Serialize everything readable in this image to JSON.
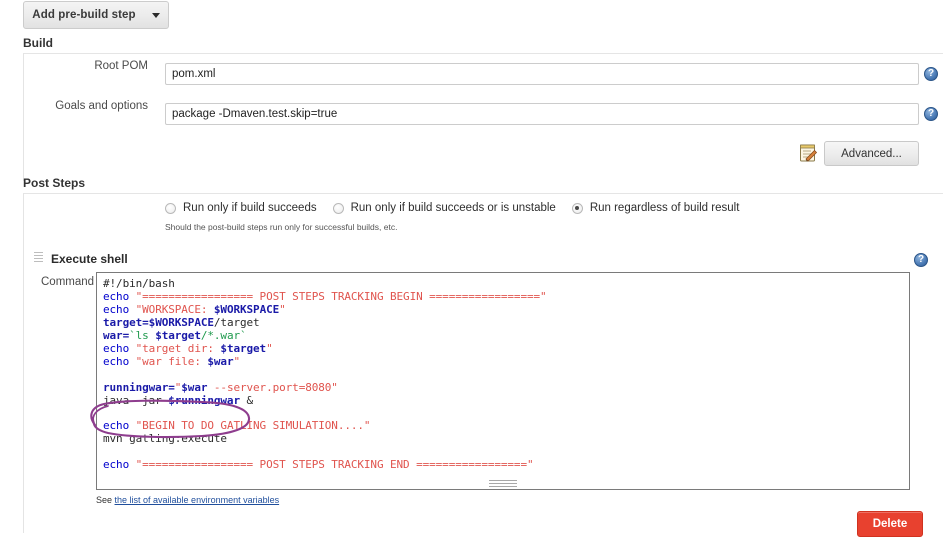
{
  "toolbar": {
    "add_prebuild_step_label": "Add pre-build step"
  },
  "build_section": {
    "heading": "Build",
    "rows": [
      {
        "label": "Root POM",
        "value": "pom.xml",
        "placeholder": ""
      },
      {
        "label": "Goals and options",
        "value": "package -Dmaven.test.skip=true",
        "placeholder": ""
      }
    ],
    "advanced_button_label": "Advanced..."
  },
  "post_steps_section": {
    "heading": "Post Steps",
    "radio_options": [
      {
        "label": "Run only if build succeeds",
        "checked": false
      },
      {
        "label": "Run only if build succeeds or is unstable",
        "checked": false
      },
      {
        "label": "Run regardless of build result",
        "checked": true
      }
    ],
    "hint": "Should the post-build steps run only for successful builds, etc."
  },
  "execute_shell": {
    "title": "Execute shell",
    "command_label": "Command",
    "script": "#!/bin/bash\necho \"================= POST STEPS TRACKING BEGIN =================\"\necho \"WORKSPACE: $WORKSPACE\"\ntarget=$WORKSPACE/target\nwar=`ls $target/*.war`\necho \"target dir: $target\"\necho \"war file: $war\"\n\nrunningwar=\"$war --server.port=8080\"\njava -jar $runningwar &\n\necho \"BEGIN TO DO GATLING SIMULATION....\"\nmvn gatling:execute\n\necho \"================= POST STEPS TRACKING END =================\"",
    "script_lines": [
      {
        "tokens": [
          {
            "t": "#!/bin/bash",
            "c": "c"
          }
        ]
      },
      {
        "tokens": [
          {
            "t": "echo",
            "c": "k"
          },
          {
            "t": " ",
            "c": "p"
          },
          {
            "t": "\"================= POST STEPS TRACKING BEGIN =================\"",
            "c": "s"
          }
        ]
      },
      {
        "tokens": [
          {
            "t": "echo",
            "c": "k"
          },
          {
            "t": " ",
            "c": "p"
          },
          {
            "t": "\"WORKSPACE: ",
            "c": "s"
          },
          {
            "t": "$WORKSPACE",
            "c": "v"
          },
          {
            "t": "\"",
            "c": "s"
          }
        ]
      },
      {
        "tokens": [
          {
            "t": "target=",
            "c": "v"
          },
          {
            "t": "$WORKSPACE",
            "c": "v"
          },
          {
            "t": "/target",
            "c": "p"
          }
        ]
      },
      {
        "tokens": [
          {
            "t": "war=",
            "c": "v"
          },
          {
            "t": "`ls ",
            "c": "g"
          },
          {
            "t": "$target",
            "c": "v"
          },
          {
            "t": "/*.war`",
            "c": "g"
          }
        ]
      },
      {
        "tokens": [
          {
            "t": "echo",
            "c": "k"
          },
          {
            "t": " ",
            "c": "p"
          },
          {
            "t": "\"target dir: ",
            "c": "s"
          },
          {
            "t": "$target",
            "c": "v"
          },
          {
            "t": "\"",
            "c": "s"
          }
        ]
      },
      {
        "tokens": [
          {
            "t": "echo",
            "c": "k"
          },
          {
            "t": " ",
            "c": "p"
          },
          {
            "t": "\"war file: ",
            "c": "s"
          },
          {
            "t": "$war",
            "c": "v"
          },
          {
            "t": "\"",
            "c": "s"
          }
        ]
      },
      {
        "tokens": []
      },
      {
        "tokens": [
          {
            "t": "runningwar=",
            "c": "v"
          },
          {
            "t": "\"",
            "c": "s"
          },
          {
            "t": "$war",
            "c": "v"
          },
          {
            "t": " --server.port=8080\"",
            "c": "s"
          }
        ]
      },
      {
        "tokens": [
          {
            "t": "java -jar ",
            "c": "p"
          },
          {
            "t": "$runningwar",
            "c": "v"
          },
          {
            "t": " &",
            "c": "p"
          }
        ]
      },
      {
        "tokens": []
      },
      {
        "tokens": [
          {
            "t": "echo",
            "c": "k"
          },
          {
            "t": " ",
            "c": "p"
          },
          {
            "t": "\"BEGIN TO DO GATLING SIMULATION....\"",
            "c": "s"
          }
        ]
      },
      {
        "tokens": [
          {
            "t": "mvn gatling:execute",
            "c": "p"
          }
        ]
      },
      {
        "tokens": []
      },
      {
        "tokens": [
          {
            "t": "echo",
            "c": "k"
          },
          {
            "t": " ",
            "c": "p"
          },
          {
            "t": "\"================= POST STEPS TRACKING END =================\"",
            "c": "s"
          }
        ]
      }
    ],
    "env_note_prefix": "See ",
    "env_note_link": "the list of available environment variables"
  },
  "footer": {
    "delete_label": "Delete"
  },
  "icons": {
    "dropdown_caret": "chevron-down-icon",
    "help": "help-icon",
    "notepad": "notepad-pencil-icon",
    "drag_grip": "drag-handle-icon",
    "resize": "resize-grip-icon"
  },
  "colors": {
    "annotation_purple": "#8e3d8e",
    "delete_red": "#e8412f",
    "link_blue": "#1f4e9c",
    "string_red": "#e0544e",
    "keyword_blue": "#0000cd",
    "variable_blue": "#1a1aa8",
    "subshell_green": "#1f9a4d"
  }
}
